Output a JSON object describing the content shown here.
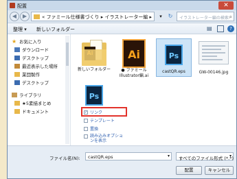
{
  "window": {
    "title": "配置"
  },
  "address": {
    "back": "◀",
    "forward": "▶",
    "path": "« ファミール仕様書づくり ▸ イラストレーター編 ▸",
    "search_placeholder": "イラストレーター編の検索"
  },
  "toolbar": {
    "organize": "整理 ▾",
    "new_folder": "新しいフォルダー"
  },
  "sidebar": {
    "items": [
      {
        "label": "お気に入り",
        "icon": "star-icon"
      },
      {
        "label": "ダウンロード",
        "icon": "download-icon"
      },
      {
        "label": "デスクトップ",
        "icon": "desktop-icon"
      },
      {
        "label": "最近表示した場所",
        "icon": "recent-places-icon"
      },
      {
        "label": "業団製作",
        "icon": "folder-icon"
      },
      {
        "label": "デスクトップ",
        "icon": "desktop-icon"
      },
      {
        "label": "ライブラリ",
        "icon": "library-icon"
      },
      {
        "label": "★5素描まとめ",
        "icon": "folder-icon"
      },
      {
        "label": "ドキュメント",
        "icon": "documents-icon"
      }
    ]
  },
  "files": [
    {
      "label": "新しいフォルダー",
      "type": "folder"
    },
    {
      "label": "● ファミール Illustrator編.ai",
      "type": "ai"
    },
    {
      "label": "castQR.eps",
      "type": "ps",
      "selected": true
    },
    {
      "label": "GW-00146.jpg",
      "type": "jpg"
    },
    {
      "label": "",
      "type": "ps"
    }
  ],
  "options": [
    {
      "label": "リンク",
      "checked": true
    },
    {
      "label": "テンプレート",
      "checked": false
    },
    {
      "label": "置換",
      "checked": false
    },
    {
      "label": "読み込みオプションを表示",
      "checked": false
    }
  ],
  "bottom": {
    "filename_label": "ファイル名(N):",
    "filename_value": "castQR.eps",
    "filetype_value": "すべてのファイル形式 (*.*)",
    "place_button": "配置",
    "cancel_button": "キャンセル"
  }
}
